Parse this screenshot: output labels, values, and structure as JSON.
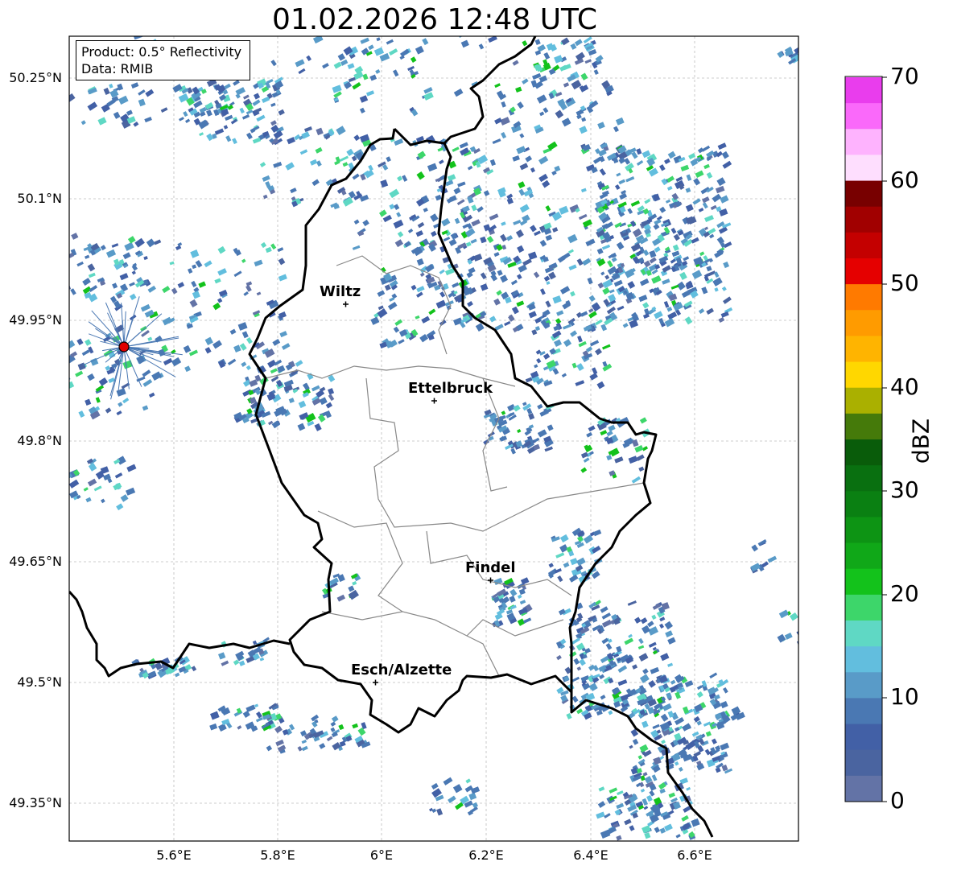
{
  "title": "01.02.2026 12:48 UTC",
  "info": {
    "product": "Product: 0.5° Reflectivity",
    "source": "Data: RMIB"
  },
  "axes": {
    "lat_ticks": [
      "50.25°N",
      "50.1°N",
      "49.95°N",
      "49.8°N",
      "49.65°N",
      "49.5°N",
      "49.35°N"
    ],
    "lon_ticks": [
      "5.6°E",
      "5.8°E",
      "6°E",
      "6.2°E",
      "6.4°E",
      "6.6°E"
    ]
  },
  "colorbar": {
    "label": "dBZ",
    "ticks": [
      "70",
      "60",
      "50",
      "40",
      "30",
      "20",
      "10",
      "0"
    ],
    "colors": [
      "#e93ded",
      "#fa69fa",
      "#feb3fe",
      "#fedefe",
      "#780000",
      "#a10000",
      "#c40000",
      "#e50000",
      "#ff7a00",
      "#ff9b00",
      "#ffb400",
      "#ffd700",
      "#aab000",
      "#457a0a",
      "#095c0a",
      "#097010",
      "#0a8012",
      "#0d9414",
      "#10a818",
      "#13c21b",
      "#3dd66a",
      "#5fd8c4",
      "#62bede",
      "#599bc8",
      "#4a78b3",
      "#4260a6",
      "#4a64a0",
      "#6373a6"
    ]
  },
  "cities": [
    {
      "name": "Wiltz"
    },
    {
      "name": "Ettelbruck"
    },
    {
      "name": "Findel"
    },
    {
      "name": "Esch/Alzette"
    }
  ],
  "radar_site": "radar-site"
}
